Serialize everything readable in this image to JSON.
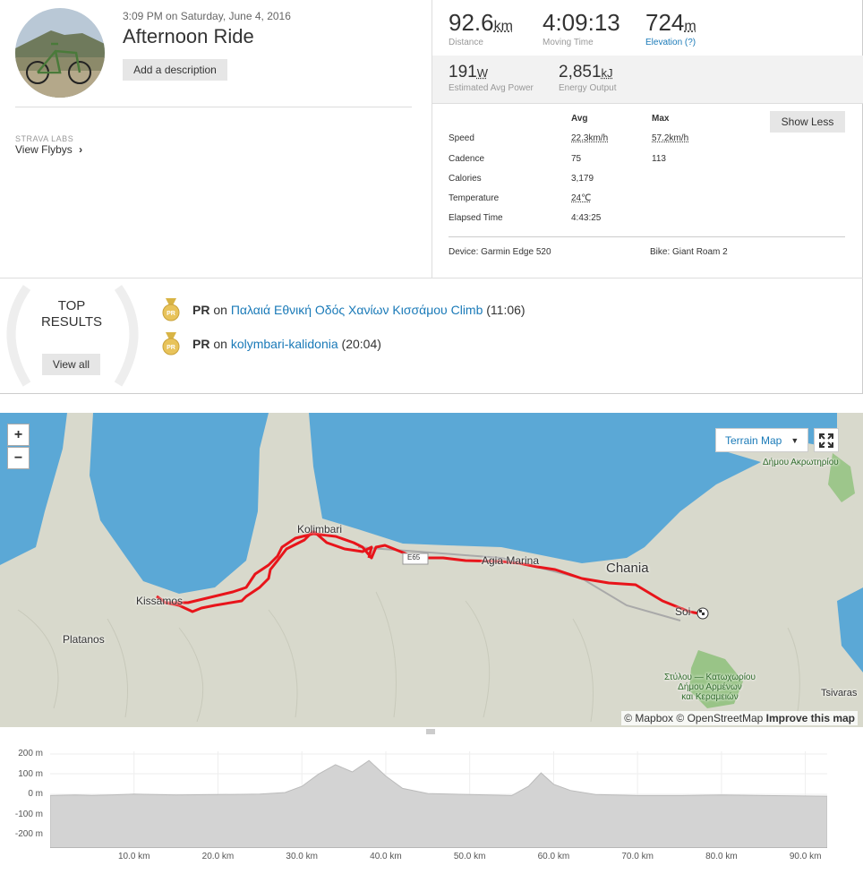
{
  "activity": {
    "date": "3:09 PM on Saturday, June 4, 2016",
    "title": "Afternoon Ride",
    "add_description": "Add a description",
    "labs_label": "STRAVA LABS",
    "flybys": "View Flybys"
  },
  "stats": {
    "distance": {
      "value": "92.6",
      "unit": "km",
      "label": "Distance"
    },
    "moving_time": {
      "value": "4:09:13",
      "label": "Moving Time"
    },
    "elevation": {
      "value": "724",
      "unit": "m",
      "label": "Elevation (?)"
    },
    "power": {
      "value": "191",
      "unit": "W",
      "label": "Estimated Avg Power"
    },
    "energy": {
      "value": "2,851",
      "unit": "kJ",
      "label": "Energy Output"
    }
  },
  "details": {
    "col_avg": "Avg",
    "col_max": "Max",
    "show_less": "Show Less",
    "rows": [
      {
        "label": "Speed",
        "avg": "22.3km/h",
        "max": "57.2km/h"
      },
      {
        "label": "Cadence",
        "avg": "75",
        "max": "113"
      },
      {
        "label": "Calories",
        "avg": "3,179",
        "max": ""
      },
      {
        "label": "Temperature",
        "avg": "24℃",
        "max": ""
      },
      {
        "label": "Elapsed Time",
        "avg": "4:43:25",
        "max": ""
      }
    ],
    "device": "Device: Garmin Edge 520",
    "bike": "Bike: Giant Roam 2"
  },
  "results": {
    "title_line1": "TOP",
    "title_line2": "RESULTS",
    "view_all": "View all",
    "items": [
      {
        "badge": "PR",
        "pr": "PR",
        "on": "on",
        "segment": "Παλαιά Εθνική Οδός Χανίων Κισσάμου Climb",
        "time": "(11:06)"
      },
      {
        "badge": "PR",
        "pr": "PR",
        "on": "on",
        "segment": "kolymbari-kalidonia",
        "time": "(20:04)"
      }
    ]
  },
  "map": {
    "zoom_in": "+",
    "zoom_out": "−",
    "map_type": "Terrain Map",
    "labels": {
      "kolimbari": "Kolimbari",
      "kissamos": "Kissamos",
      "platanos": "Platanos",
      "agia_marina": "Agia Marina",
      "chania": "Chania",
      "souda": "Soi",
      "tsivaras": "Tsivaras",
      "akrotiri": "Δήμου Ακρωτηρίου",
      "stylos": "Στύλου — Κατωχωρίου",
      "stylos2": "Δήμου Αρμένων",
      "stylos3": "και Κεραμειών",
      "road": "E65"
    },
    "attribution_mapbox": "© Mapbox",
    "attribution_osm": "© OpenStreetMap",
    "attribution_improve": "Improve this map",
    "colors": {
      "water": "#5ba8d6",
      "land": "#d8d9cc",
      "route": "#e8141a"
    }
  },
  "elevation_chart": {
    "y_ticks": [
      "200 m",
      "100 m",
      "0 m",
      "-100 m",
      "-200 m"
    ],
    "x_ticks": [
      "10.0 km",
      "20.0 km",
      "30.0 km",
      "40.0 km",
      "50.0 km",
      "60.0 km",
      "70.0 km",
      "80.0 km",
      "90.0 km"
    ]
  },
  "chart_data": {
    "type": "area",
    "title": "",
    "xlabel": "",
    "ylabel": "",
    "x_unit": "km",
    "y_unit": "m",
    "ylim": [
      -250,
      220
    ],
    "xlim": [
      0,
      92.6
    ],
    "x": [
      0,
      3,
      5,
      8,
      10,
      15,
      20,
      25,
      28,
      30,
      32,
      34,
      36,
      38,
      40,
      42,
      45,
      50,
      55,
      57,
      58.5,
      60,
      62,
      65,
      70,
      75,
      80,
      85,
      90,
      92.6
    ],
    "y": [
      5,
      8,
      6,
      9,
      12,
      8,
      10,
      12,
      20,
      50,
      110,
      155,
      120,
      175,
      100,
      40,
      15,
      10,
      5,
      50,
      115,
      60,
      30,
      10,
      5,
      5,
      8,
      5,
      3,
      2
    ]
  }
}
